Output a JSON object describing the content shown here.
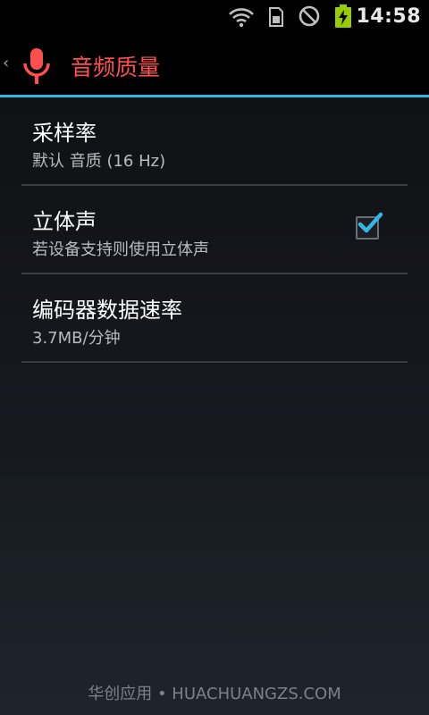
{
  "status_bar": {
    "time": "14:58",
    "icons": [
      "wifi-icon",
      "sim-card-icon",
      "blocked-icon",
      "battery-charging-icon"
    ],
    "battery_color": "#99cc00"
  },
  "action_bar": {
    "up_glyph": "‹",
    "icon": "microphone-icon",
    "title": "音频质量",
    "title_color": "#ff4f4f",
    "divider_color": "#33b5e5"
  },
  "preferences": [
    {
      "title": "采样率",
      "summary": "默认 音质 (16 Hz)",
      "has_checkbox": false
    },
    {
      "title": "立体声",
      "summary": "若设备支持则使用立体声",
      "has_checkbox": true,
      "checked": true
    },
    {
      "title": "编码器数据速率",
      "summary": "3.7MB/分钟",
      "has_checkbox": false
    }
  ],
  "watermark": "华创应用 • HUACHUANGZS.COM"
}
